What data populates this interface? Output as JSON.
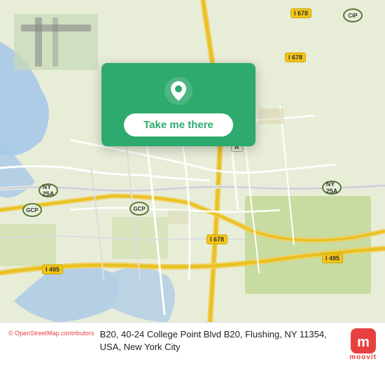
{
  "map": {
    "attribution": "© OpenStreetMap contributors",
    "center_lat": 40.763,
    "center_lng": -73.831
  },
  "location_card": {
    "button_label": "Take me there",
    "pin_color": "#ffffff"
  },
  "bottom_bar": {
    "address": "B20, 40-24 College Point Blvd B20, Flushing, NY 11354, USA, New York City"
  },
  "road_labels": [
    {
      "id": "ny25a-left",
      "text": "NY 25A",
      "type": "state"
    },
    {
      "id": "ny25a-right",
      "text": "NY 25A",
      "type": "state"
    },
    {
      "id": "i495-left",
      "text": "I 495",
      "type": "highway"
    },
    {
      "id": "i495-right",
      "text": "I 495",
      "type": "highway"
    },
    {
      "id": "i678-top",
      "text": "I 678",
      "type": "highway"
    },
    {
      "id": "i678-mid",
      "text": "I 678",
      "type": "highway"
    },
    {
      "id": "i678-bot",
      "text": "I 678",
      "type": "highway"
    },
    {
      "id": "gcp-left",
      "text": "GCP",
      "type": "state"
    },
    {
      "id": "gcp-bottom",
      "text": "GCP",
      "type": "state"
    },
    {
      "id": "cip",
      "text": "CIP",
      "type": "state"
    }
  ],
  "moovit": {
    "name": "moovit"
  }
}
